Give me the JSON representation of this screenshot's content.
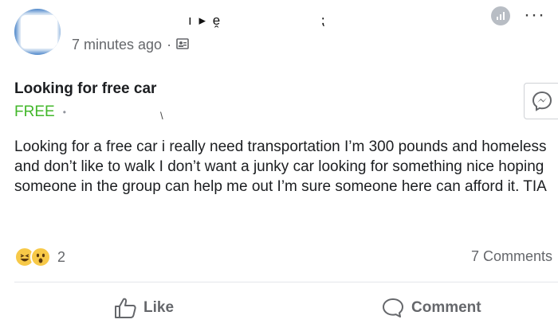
{
  "post": {
    "author_garble": "ı ▸ ḙ",
    "author_garble2": "⁏",
    "time": "7 minutes ago",
    "title": "Looking for free car",
    "price": "FREE",
    "location_mark": "\\",
    "body": "Looking for a free car i really need transportation I’m 300 pounds and homeless and don’t like to walk I don’t want a junky car looking for something nice hoping someone in the group can help me out I’m sure someone here can afford it. TIA",
    "reaction_count": "2",
    "comments_label": "7 Comments"
  },
  "actions": {
    "like_label": "Like",
    "comment_label": "Comment"
  },
  "icons": [
    "privacy-icon",
    "stats-icon",
    "more-icon",
    "messenger-icon",
    "haha-emoji-icon",
    "wow-emoji-icon",
    "like-icon",
    "comment-icon"
  ],
  "colors": {
    "price_green": "#42b72a",
    "meta_gray": "#65676b",
    "avatar_blue": "#4b86c9",
    "reaction_yellow": "#f7c948"
  }
}
